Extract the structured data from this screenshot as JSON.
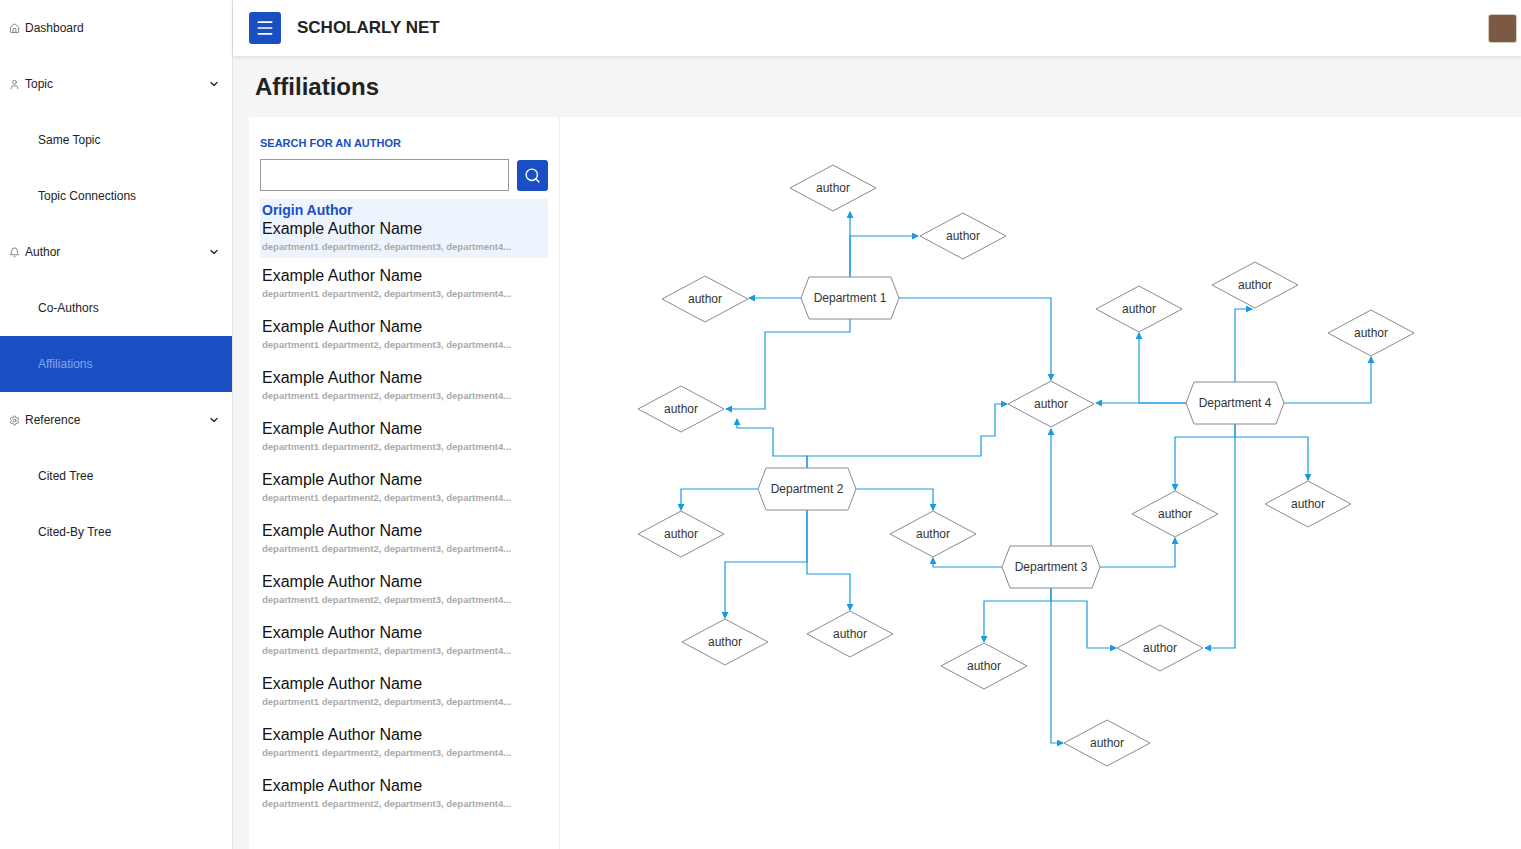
{
  "app": {
    "title": "SCHOLARLY NET"
  },
  "sidebar": {
    "items": [
      {
        "label": "Dashboard",
        "kind": "link",
        "selected": false
      },
      {
        "label": "Topic",
        "kind": "section",
        "expanded": true,
        "selected": false
      },
      {
        "label": "Same Topic",
        "kind": "sub",
        "selected": false
      },
      {
        "label": "Topic Connections",
        "kind": "sub",
        "selected": false
      },
      {
        "label": "Author",
        "kind": "section",
        "expanded": true,
        "selected": false
      },
      {
        "label": "Co-Authors",
        "kind": "sub",
        "selected": false
      },
      {
        "label": "Affiliations",
        "kind": "sub",
        "selected": true
      },
      {
        "label": "Reference",
        "kind": "section",
        "expanded": true,
        "selected": false
      },
      {
        "label": "Cited Tree",
        "kind": "sub",
        "selected": false
      },
      {
        "label": "Cited-By Tree",
        "kind": "sub",
        "selected": false
      }
    ]
  },
  "page": {
    "title": "Affiliations"
  },
  "search": {
    "label": "SEARCH FOR AN AUTHOR",
    "value": ""
  },
  "authors": [
    {
      "badge": "Origin Author",
      "name": "Example Author Name",
      "departments": "department1 department2, department3, department4...",
      "selected": true
    },
    {
      "name": "Example Author Name",
      "departments": "department1 department2, department3, department4...",
      "selected": false
    },
    {
      "name": "Example Author Name",
      "departments": "department1 department2, department3, department4...",
      "selected": false
    },
    {
      "name": "Example Author Name",
      "departments": "department1 department2, department3, department4...",
      "selected": false
    },
    {
      "name": "Example Author Name",
      "departments": "department1 department2, department3, department4...",
      "selected": false
    },
    {
      "name": "Example Author Name",
      "departments": "department1 department2, department3, department4...",
      "selected": false
    },
    {
      "name": "Example Author Name",
      "departments": "department1 department2, department3, department4...",
      "selected": false
    },
    {
      "name": "Example Author Name",
      "departments": "department1 department2, department3, department4...",
      "selected": false
    },
    {
      "name": "Example Author Name",
      "departments": "department1 department2, department3, department4...",
      "selected": false
    },
    {
      "name": "Example Author Name",
      "departments": "department1 department2, department3, department4...",
      "selected": false
    },
    {
      "name": "Example Author Name",
      "departments": "department1 department2, department3, department4...",
      "selected": false
    },
    {
      "name": "Example Author Name",
      "departments": "department1 department2, department3, department4...",
      "selected": false
    }
  ],
  "diagram": {
    "departments": [
      {
        "label": "Department 1"
      },
      {
        "label": "Department 2"
      },
      {
        "label": "Department 3"
      },
      {
        "label": "Department 4"
      }
    ],
    "authors": [
      {
        "label": "author"
      },
      {
        "label": "author"
      },
      {
        "label": "author"
      },
      {
        "label": "author"
      },
      {
        "label": "author"
      },
      {
        "label": "author"
      },
      {
        "label": "author"
      },
      {
        "label": "author"
      },
      {
        "label": "author"
      },
      {
        "label": "author"
      },
      {
        "label": "author"
      },
      {
        "label": "author"
      },
      {
        "label": "author"
      },
      {
        "label": "author"
      },
      {
        "label": "author"
      },
      {
        "label": "author"
      },
      {
        "label": "author"
      }
    ]
  }
}
